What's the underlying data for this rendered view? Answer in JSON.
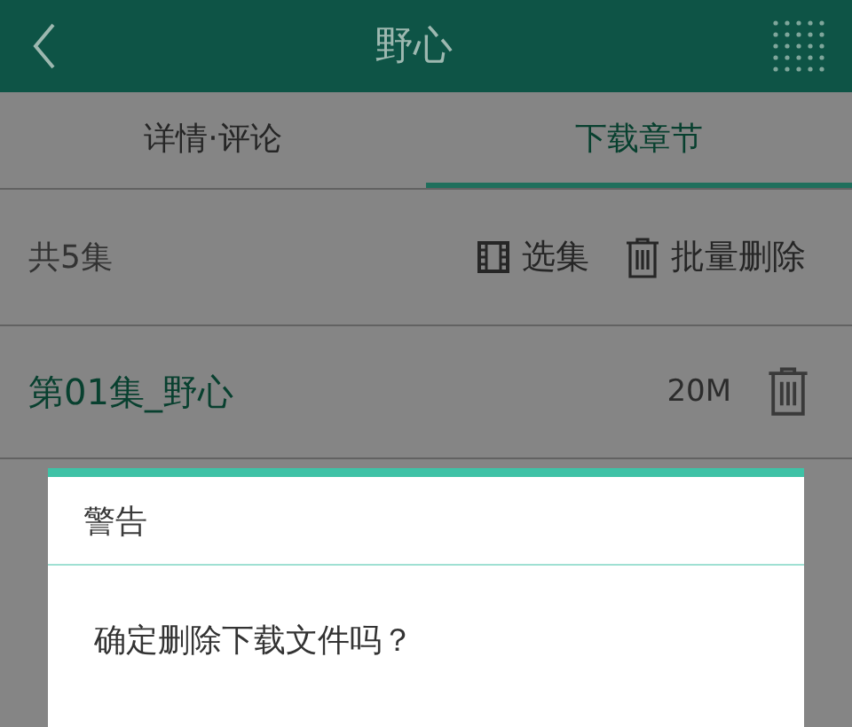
{
  "header": {
    "title": "野心"
  },
  "tabs": [
    {
      "label": "详情·评论",
      "selected": false
    },
    {
      "label": "下载章节",
      "selected": true
    }
  ],
  "summary": {
    "count": "共5集",
    "actions": [
      {
        "kind": "film",
        "label": "选集"
      },
      {
        "kind": "trash",
        "label": "批量删除"
      }
    ]
  },
  "episodes": [
    {
      "title": "第01集_野心",
      "size": "20M",
      "highlighted": true
    }
  ],
  "dialog": {
    "title": "警告",
    "message": "确定删除下载文件吗？"
  }
}
